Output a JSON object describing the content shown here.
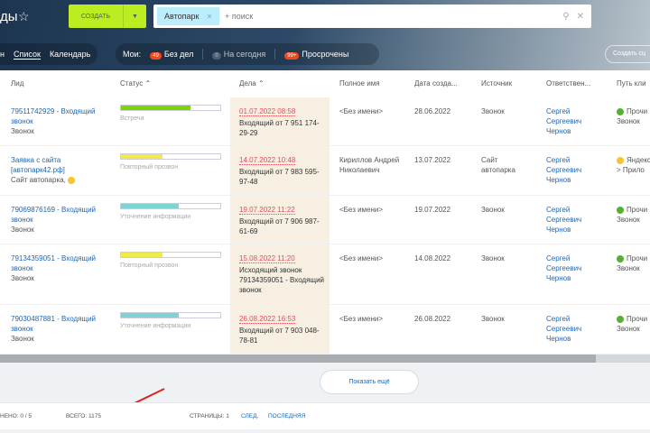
{
  "header": {
    "title": "ды",
    "create_label": "создать",
    "search_chip": "Автопарк",
    "search_placeholder": "+ поиск"
  },
  "view_tabs": [
    {
      "label": "н"
    },
    {
      "label": "Список",
      "active": true
    },
    {
      "label": "Календарь"
    }
  ],
  "counters": {
    "label": "Мои:",
    "items": [
      {
        "badge": "49",
        "label": "Без дел"
      },
      {
        "badge": "0",
        "label": "На сегодня"
      },
      {
        "badge": "99+",
        "label": "Просрочены"
      }
    ]
  },
  "create_scenario": "Создать сц",
  "columns": [
    "Лид",
    "Статус ⌃",
    "Дела ⌃",
    "Полное имя",
    "Дата созда...",
    "Источник",
    "Ответствен...",
    "Путь кли"
  ],
  "rows": [
    {
      "lead": "79511742929 - Входящий звонок",
      "lead_sub": "Звонок",
      "status": "Встреча",
      "progress": 0.7,
      "color": "#7bd500",
      "deal_date": "01.07.2022 08:58",
      "deal_text": "Входящий от 7 951 174-29-29",
      "name": "<Без имени>",
      "created": "28.06.2022",
      "source": "Звонок",
      "owner": "Сергей Сергеевич Чернов",
      "path": "Прочи",
      "path_sub": "Звонок",
      "path_color": "#55b033"
    },
    {
      "lead": "Заявка с сайта [автопарк42.рф]",
      "lead_sub": "Сайт автопарка,",
      "status": "Повторный прозвон",
      "progress": 0.42,
      "color": "#f0ea4a",
      "deal_date": "14.07.2022 10:48",
      "deal_text": "Входящий от 7 983 595-97-48",
      "name": "Кириллов Андрей Николаевич",
      "created": "13.07.2022",
      "source": "Сайт автопарка",
      "owner": "Сергей Сергеевич Чернов",
      "path": "Яндекс",
      "path_sub": "> Прило",
      "path_color": "#f7c531"
    },
    {
      "lead": "79069876169 - Входящий звонок",
      "lead_sub": "Звонок",
      "status": "Уточнение информации",
      "progress": 0.58,
      "color": "#7dd3d3",
      "deal_date": "19.07.2022 11:22",
      "deal_text": "Входящий от 7 906 987-61-69",
      "name": "<Без имени>",
      "created": "19.07.2022",
      "source": "Звонок",
      "owner": "Сергей Сергеевич Чернов",
      "path": "Прочи",
      "path_sub": "Звонок",
      "path_color": "#55b033"
    },
    {
      "lead": "79134359051 - Входящий звонок",
      "lead_sub": "Звонок",
      "status": "Повторный прозвон",
      "progress": 0.42,
      "color": "#f0ea4a",
      "deal_date": "15.08.2022 11:20",
      "deal_text": "Исходящий звонок 79134359051 - Входящий звонок",
      "name": "<Без имени>",
      "created": "14.08.2022",
      "source": "Звонок",
      "owner": "Сергей Сергеевич Чернов",
      "path": "Прочи",
      "path_sub": "Звонок",
      "path_color": "#55b033"
    },
    {
      "lead": "79030487881 - Входящий звонок",
      "lead_sub": "Звонок",
      "status": "Уточнение информации",
      "progress": 0.58,
      "color": "#7dd3d3",
      "deal_date": "26.08.2022 16:53",
      "deal_text": "Входящий от 7 903 048-78-81",
      "name": "<Без имени>",
      "created": "26.08.2022",
      "source": "Звонок",
      "owner": "Сергей Сергеевич Чернов",
      "path": "Прочи",
      "path_sub": "Звонок",
      "path_color": "#55b033"
    }
  ],
  "show_more": "Показать ещё",
  "footer": {
    "selected": "нено: 0 / 5",
    "total": "Всего: 1175",
    "pages": "Страницы: 1",
    "next": "След.",
    "last": "Последняя"
  }
}
